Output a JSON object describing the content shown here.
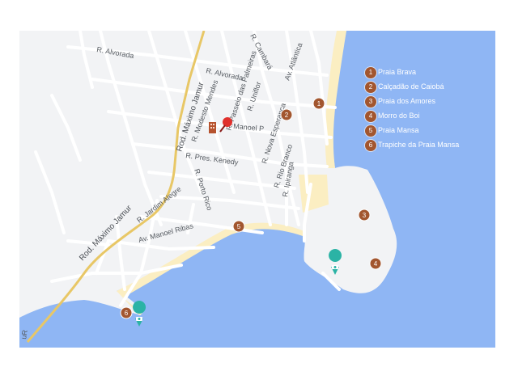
{
  "map": {
    "roads": {
      "r_alvorada_west": "R. Alvorada",
      "r_alvorada": "R. Alvorada",
      "r_cambara": "R. Cambará",
      "av_atlantica": "Av. Atlântica",
      "rod_masimo_jamur_top": "Rod. Máximo Jamur",
      "rod_masimo_jamur_bottom": "Rod. Máximo Jamur",
      "r_modesto_mendes": "R. Modesto Mendes",
      "r_passeio_das_palmeiras": "R. Passeio das Palmeiras",
      "r_uniflor": "R. Uniflor",
      "r_manoel_p": "Manoel P",
      "r_nova_esperanca": "R. Nova Esperança",
      "r_pres_kenedy": "R. Pres. Kenedy",
      "r_rio_branco": "R. Rio Branco",
      "r_porto_rico": "R. Porto Rico",
      "r_jardim_alegre": "R. Jardim Alegre",
      "av_manoel_ribas": "Av. Manoel Ribas",
      "r_ipiranga": "R. Ipiranga",
      "edge_text": "uR"
    },
    "markers": [
      {
        "number": "1",
        "label": "Praia Brava"
      },
      {
        "number": "2",
        "label": "Calçadão de Caiobá"
      },
      {
        "number": "3",
        "label": "Praia dos Amores"
      },
      {
        "number": "4",
        "label": "Morro do Boi"
      },
      {
        "number": "5",
        "label": "Praia Mansa"
      },
      {
        "number": "6",
        "label": "Trapiche da Praia Mansa"
      }
    ],
    "icons": {
      "photo_icon": "camera-pin-icon",
      "hotel_icon": "hotel-icon",
      "location_pin": "red-pushpin-icon"
    },
    "colors": {
      "water": "#8fb6f4",
      "land": "#f2f3f5",
      "beach": "#fbeec2",
      "road": "#ffffff",
      "highway": "#e8c766",
      "marker": "#a2562f",
      "photo_pin": "#2bb3a5",
      "pushpin": "#e0302c"
    }
  }
}
